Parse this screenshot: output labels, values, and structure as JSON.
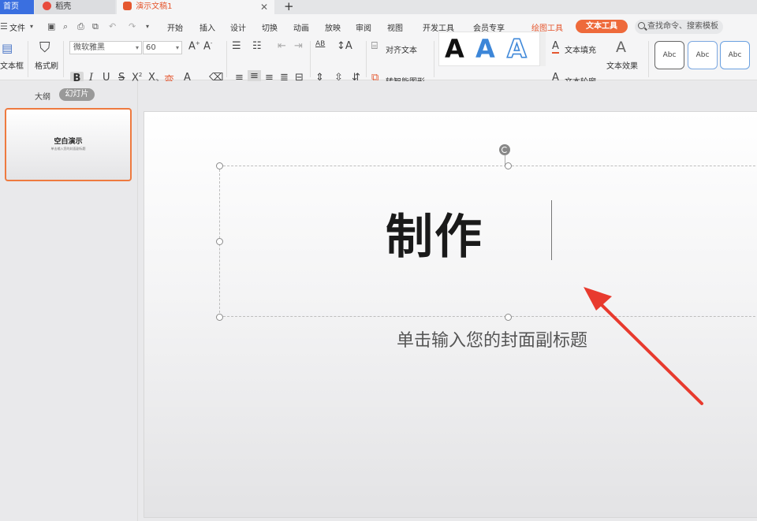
{
  "tabs": {
    "home": "首页",
    "daoke": "稻壳",
    "doc": "演示文稿1",
    "close": "✕",
    "add": "+"
  },
  "menu": {
    "file": "文件",
    "items": [
      "开始",
      "插入",
      "设计",
      "切换",
      "动画",
      "放映",
      "审阅",
      "视图",
      "开发工具",
      "会员专享"
    ],
    "drawing_tools": "绘图工具",
    "text_tools": "文本工具",
    "search_placeholder": "查找命令、搜索模板"
  },
  "toolbar": {
    "textbox_label": "文本框",
    "format_painter_label": "格式刷",
    "font_name": "微软雅黑",
    "font_size": "60",
    "align_text_label": "对齐文本",
    "smart_shape_label": "转智能图形",
    "text_fill_label": "文本填充",
    "text_outline_label": "文本轮廓",
    "text_effect_label": "文本效果",
    "art_letter": "A",
    "style_samples": [
      "Abc",
      "Abc",
      "Abc"
    ]
  },
  "left_panel": {
    "outline_tab": "大纲",
    "slides_tab": "幻灯片",
    "thumb_title": "空白演示",
    "thumb_subtitle": "单击输入您的封面副标题"
  },
  "slide": {
    "title": "制作",
    "subtitle": "单击输入您的封面副标题"
  },
  "colors": {
    "accent_orange": "#ee6a3b",
    "home_tab_blue": "#3a6fe0",
    "annotation_arrow": "#e83a2e"
  }
}
